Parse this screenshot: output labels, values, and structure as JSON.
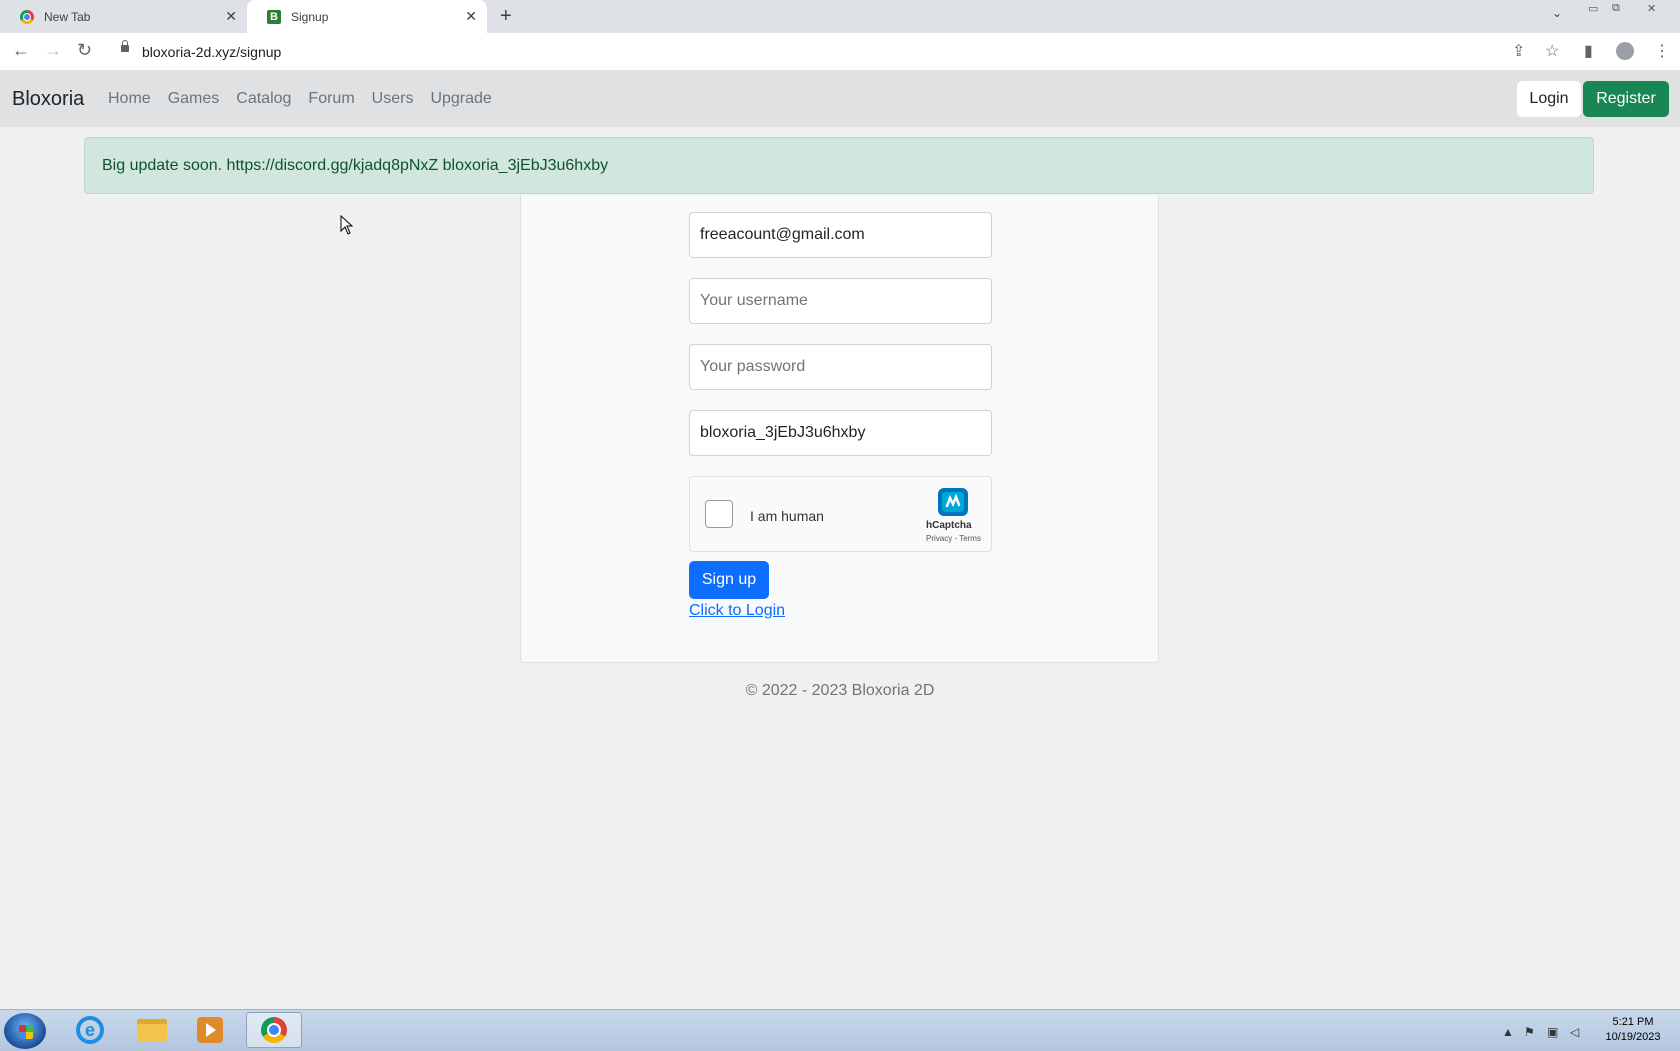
{
  "browser": {
    "tabs": [
      {
        "label": "New Tab",
        "active": false
      },
      {
        "label": "Signup",
        "active": true
      }
    ],
    "url": "bloxoria-2d.xyz/signup"
  },
  "site": {
    "brand": "Bloxoria",
    "nav": [
      "Home",
      "Games",
      "Catalog",
      "Forum",
      "Users",
      "Upgrade"
    ],
    "login_label": "Login",
    "register_label": "Register"
  },
  "alert": {
    "text": "Big update soon. https://discord.gg/kjadq8pNxZ bloxoria_3jEbJ3u6hxby"
  },
  "form": {
    "email_value": "freeacount@gmail.com",
    "username_placeholder": "Your username",
    "password_placeholder": "Your password",
    "code_value": "bloxoria_3jEbJ3u6hxby",
    "captcha": {
      "label": "I am human",
      "brand": "hCaptcha",
      "links": "Privacy - Terms"
    },
    "signup_label": "Sign up",
    "login_link": "Click to Login"
  },
  "footer": "© 2022 - 2023 Bloxoria 2D",
  "taskbar": {
    "time": "5:21 PM",
    "date": "10/19/2023"
  },
  "colors": {
    "register": "#198754",
    "signup": "#0d6efd",
    "alert_bg": "#d1e7dd",
    "navbar_bg": "#dfe1e3"
  }
}
